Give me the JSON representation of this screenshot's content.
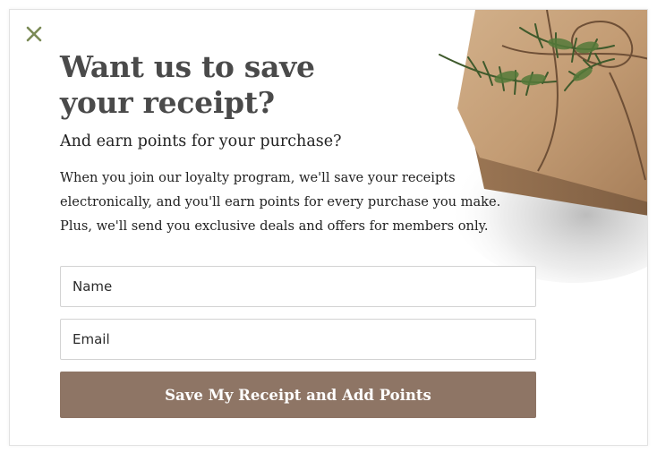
{
  "popup": {
    "close_icon": "close-icon",
    "headline": "Want us to save your receipt?",
    "subheadline": "And earn points for your purchase?",
    "body": "When you join our loyalty program, we'll save your receipts electronically, and you'll earn points for every purchase you make. Plus, we'll send you exclusive deals and offers for members only.",
    "form": {
      "name_placeholder": "Name",
      "email_placeholder": "Email",
      "submit_label": "Save My Receipt and Add Points"
    },
    "image_icon": "gift-box-image"
  },
  "colors": {
    "accent_button": "#8e7565",
    "close_icon": "#7a8a55",
    "headline": "#4a4a4a",
    "body_text": "#222222"
  }
}
